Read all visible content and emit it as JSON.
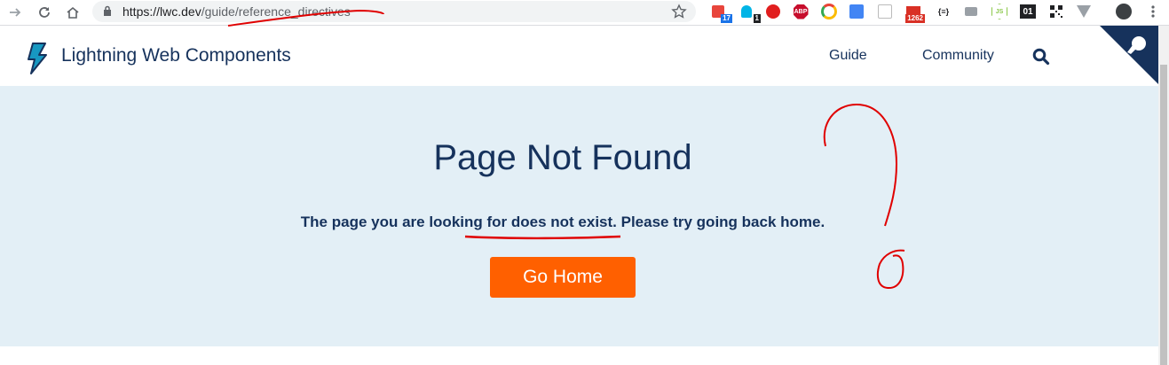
{
  "browser": {
    "url_host": "https://lwc.dev",
    "url_path": "/guide/reference_directives",
    "extensions": [
      {
        "icon": "calendar-ext-icon",
        "badge": "17",
        "color": "#e8453c"
      },
      {
        "icon": "ghost-ext-icon",
        "badge": "1",
        "color": "#00b4e6"
      },
      {
        "icon": "stop-hand-ext-icon",
        "badge": "",
        "color": "#e11e1e"
      },
      {
        "icon": "adblock-plus-ext-icon",
        "label": "ABP",
        "color": "#c70d2c"
      },
      {
        "icon": "chrome-circle-ext-icon",
        "color": "#fbbc05"
      },
      {
        "icon": "translate-ext-icon",
        "color": "#4285f4"
      },
      {
        "icon": "screenshot-ext-icon",
        "color": "#bbbbbb"
      },
      {
        "icon": "gmail-ext-icon",
        "badge": "1262",
        "color": "#d93025"
      },
      {
        "icon": "json-ext-icon",
        "label": "{≡}",
        "color": "#202124"
      },
      {
        "icon": "camera-ext-icon",
        "color": "#9aa0a6"
      },
      {
        "icon": "nodejs-ext-icon",
        "label": "JS",
        "color": "#8cc84b"
      },
      {
        "icon": "binary-ext-icon",
        "label": "01",
        "color": "#202124"
      },
      {
        "icon": "qr-code-ext-icon",
        "color": "#202124"
      },
      {
        "icon": "vue-ext-icon",
        "color": "#9aa0a6"
      },
      {
        "icon": "profile-avatar-icon",
        "color": "#3c4043"
      }
    ]
  },
  "site": {
    "title": "Lightning Web Components",
    "nav": {
      "guide": "Guide",
      "community": "Community"
    }
  },
  "hero": {
    "title": "Page Not Found",
    "message": "The page you are looking for does not exist. Please try going back home.",
    "button_label": "Go Home"
  },
  "colors": {
    "brand_navy": "#16325c",
    "hero_bg": "#e3eff6",
    "button": "#ff6000",
    "annotation_red": "#e00000"
  }
}
